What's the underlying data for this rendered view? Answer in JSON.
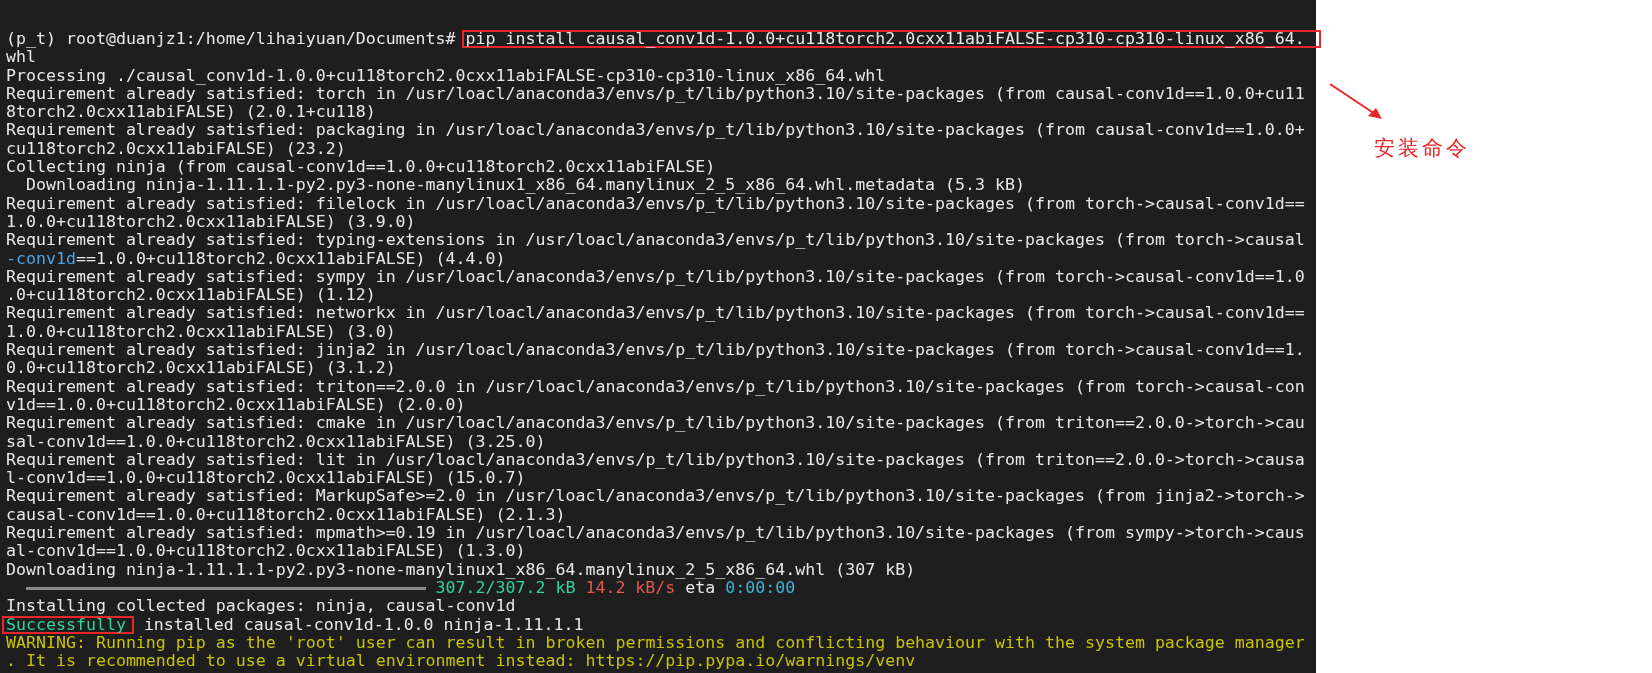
{
  "terminal": {
    "lines": [
      [
        {
          "kind": "plain",
          "text": "(p_t) root@duanjz1:/home/lihaiyuan/Documents# ",
          "boxed": false
        },
        {
          "kind": "plain",
          "text": "pip install causal_conv1d-1.0.0+cu118torch2.0cxx11abiFALSE-cp310-cp310-linux_x86_64.",
          "boxed": true
        }
      ],
      [
        {
          "kind": "plain",
          "text": "whl",
          "boxed": false
        }
      ],
      [
        {
          "kind": "plain",
          "text": "Processing ./causal_conv1d-1.0.0+cu118torch2.0cxx11abiFALSE-cp310-cp310-linux_x86_64.whl",
          "boxed": false
        }
      ],
      [
        {
          "kind": "plain",
          "text": "Requirement already satisfied: torch in /usr/loacl/anaconda3/envs/p_t/lib/python3.10/site-packages (from causal-conv1d==1.0.0+cu11",
          "boxed": false
        }
      ],
      [
        {
          "kind": "plain",
          "text": "8torch2.0cxx11abiFALSE) (2.0.1+cu118)",
          "boxed": false
        }
      ],
      [
        {
          "kind": "plain",
          "text": "Requirement already satisfied: packaging in /usr/loacl/anaconda3/envs/p_t/lib/python3.10/site-packages (from causal-conv1d==1.0.0+",
          "boxed": false
        }
      ],
      [
        {
          "kind": "plain",
          "text": "cu118torch2.0cxx11abiFALSE) (23.2)",
          "boxed": false
        }
      ],
      [
        {
          "kind": "plain",
          "text": "Collecting ninja (from causal-conv1d==1.0.0+cu118torch2.0cxx11abiFALSE)",
          "boxed": false
        }
      ],
      [
        {
          "kind": "plain",
          "text": "  Downloading ninja-1.11.1.1-py2.py3-none-manylinux1_x86_64.manylinux_2_5_x86_64.whl.metadata (5.3 kB)",
          "boxed": false
        }
      ],
      [
        {
          "kind": "plain",
          "text": "Requirement already satisfied: filelock in /usr/loacl/anaconda3/envs/p_t/lib/python3.10/site-packages (from torch->causal-conv1d==",
          "boxed": false
        }
      ],
      [
        {
          "kind": "plain",
          "text": "1.0.0+cu118torch2.0cxx11abiFALSE) (3.9.0)",
          "boxed": false
        }
      ],
      [
        {
          "kind": "plain",
          "text": "Requirement already satisfied: typing-extensions in /usr/loacl/anaconda3/envs/p_t/lib/python3.10/site-packages (from torch->causal",
          "boxed": false
        }
      ],
      [
        {
          "kind": "blue",
          "text": "-conv1d",
          "boxed": false
        },
        {
          "kind": "plain",
          "text": "==1.0.0+cu118torch2.0cxx11abiFALSE) (4.4.0)",
          "boxed": false
        }
      ],
      [
        {
          "kind": "plain",
          "text": "Requirement already satisfied: sympy in /usr/loacl/anaconda3/envs/p_t/lib/python3.10/site-packages (from torch->causal-conv1d==1.0",
          "boxed": false
        }
      ],
      [
        {
          "kind": "plain",
          "text": ".0+cu118torch2.0cxx11abiFALSE) (1.12)",
          "boxed": false
        }
      ],
      [
        {
          "kind": "plain",
          "text": "Requirement already satisfied: networkx in /usr/loacl/anaconda3/envs/p_t/lib/python3.10/site-packages (from torch->causal-conv1d==",
          "boxed": false
        }
      ],
      [
        {
          "kind": "plain",
          "text": "1.0.0+cu118torch2.0cxx11abiFALSE) (3.0)",
          "boxed": false
        }
      ],
      [
        {
          "kind": "plain",
          "text": "Requirement already satisfied: jinja2 in /usr/loacl/anaconda3/envs/p_t/lib/python3.10/site-packages (from torch->causal-conv1d==1.",
          "boxed": false
        }
      ],
      [
        {
          "kind": "plain",
          "text": "0.0+cu118torch2.0cxx11abiFALSE) (3.1.2)",
          "boxed": false
        }
      ],
      [
        {
          "kind": "plain",
          "text": "Requirement already satisfied: triton==2.0.0 in /usr/loacl/anaconda3/envs/p_t/lib/python3.10/site-packages (from torch->causal-con",
          "boxed": false
        }
      ],
      [
        {
          "kind": "plain",
          "text": "v1d==1.0.0+cu118torch2.0cxx11abiFALSE) (2.0.0)",
          "boxed": false
        }
      ],
      [
        {
          "kind": "plain",
          "text": "Requirement already satisfied: cmake in /usr/loacl/anaconda3/envs/p_t/lib/python3.10/site-packages (from triton==2.0.0->torch->cau",
          "boxed": false
        }
      ],
      [
        {
          "kind": "plain",
          "text": "sal-conv1d==1.0.0+cu118torch2.0cxx11abiFALSE) (3.25.0)",
          "boxed": false
        }
      ],
      [
        {
          "kind": "plain",
          "text": "Requirement already satisfied: lit in /usr/loacl/anaconda3/envs/p_t/lib/python3.10/site-packages (from triton==2.0.0->torch->causa",
          "boxed": false
        }
      ],
      [
        {
          "kind": "plain",
          "text": "l-conv1d==1.0.0+cu118torch2.0cxx11abiFALSE) (15.0.7)",
          "boxed": false
        }
      ],
      [
        {
          "kind": "plain",
          "text": "Requirement already satisfied: MarkupSafe>=2.0 in /usr/loacl/anaconda3/envs/p_t/lib/python3.10/site-packages (from jinja2->torch->",
          "boxed": false
        }
      ],
      [
        {
          "kind": "plain",
          "text": "causal-conv1d==1.0.0+cu118torch2.0cxx11abiFALSE) (2.1.3)",
          "boxed": false
        }
      ],
      [
        {
          "kind": "plain",
          "text": "Requirement already satisfied: mpmath>=0.19 in /usr/loacl/anaconda3/envs/p_t/lib/python3.10/site-packages (from sympy->torch->caus",
          "boxed": false
        }
      ],
      [
        {
          "kind": "plain",
          "text": "al-conv1d==1.0.0+cu118torch2.0cxx11abiFALSE) (1.3.0)",
          "boxed": false
        }
      ],
      [
        {
          "kind": "plain",
          "text": "Downloading ninja-1.11.1.1-py2.py3-none-manylinux1_x86_64.manylinux_2_5_x86_64.whl (307 kB)",
          "boxed": false
        }
      ],
      [
        {
          "kind": "bar",
          "level": 1
        },
        {
          "kind": "green",
          "text": "307.2/307.2 kB",
          "boxed": false
        },
        {
          "kind": "red",
          "text": "14.2 kB/s",
          "boxed": false
        },
        {
          "kind": "plain",
          "text": "eta",
          "boxed": false
        },
        {
          "kind": "cyan",
          "text": "0:00:00",
          "boxed": false
        }
      ],
      [
        {
          "kind": "plain",
          "text": "Installing collected packages: ninja, causal-conv1d",
          "boxed": false
        }
      ],
      [
        {
          "kind": "green",
          "text": "Successfully",
          "boxed": true
        },
        {
          "kind": "plain",
          "text": " installed causal-conv1d-1.0.0 ninja-1.11.1.1",
          "boxed": false
        }
      ],
      [
        {
          "kind": "yellow",
          "text": "WARNING: Running pip as the 'root' user can result in broken permissions and conflicting behaviour with the system package manager",
          "boxed": false
        }
      ],
      [
        {
          "kind": "yellow",
          "text": ". It is recommended to use a virtual environment instead: https://pip.pypa.io/warnings/venv",
          "boxed": false
        }
      ]
    ]
  },
  "annotation": {
    "label": "安装命令"
  }
}
